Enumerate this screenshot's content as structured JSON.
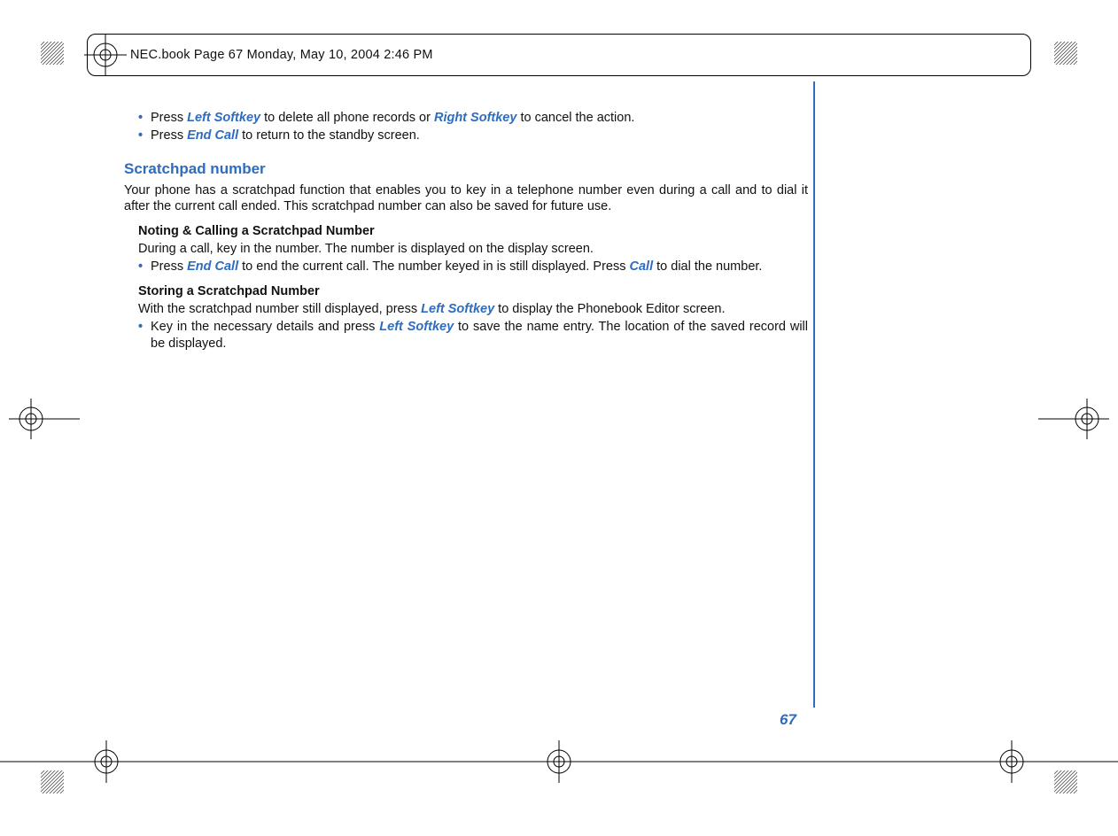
{
  "header": {
    "text": "NEC.book  Page 67  Monday, May 10, 2004  2:46 PM"
  },
  "content": {
    "topBullets": {
      "b1": {
        "t1": "Press ",
        "k1": "Left Softkey",
        "t2": " to delete all phone records or ",
        "k2": "Right Softkey",
        "t3": " to cancel the action."
      },
      "b2": {
        "t1": "Press ",
        "k1": "End Call",
        "t2": " to return to the standby screen."
      }
    },
    "section": {
      "title": "Scratchpad number",
      "intro": "Your phone has a scratchpad function that enables you to key in a telephone number even during a call and to dial it after the current call ended. This scratchpad number can also be saved for future use."
    },
    "noting": {
      "heading": "Noting & Calling a Scratchpad Number",
      "line": "During a call, key in the number. The number is displayed on the display screen.",
      "bullet": {
        "t1": "Press ",
        "k1": "End Call",
        "t2": " to end the current call. The number keyed in is still displayed. Press ",
        "k2": "Call",
        "t3": " to dial the number."
      }
    },
    "storing": {
      "heading": "Storing a Scratchpad Number",
      "line": {
        "t1": "With the scratchpad number still displayed, press ",
        "k1": "Left Softkey",
        "t2": " to display the Phonebook Editor screen."
      },
      "bullet": {
        "t1": "Key in the necessary details and press ",
        "k1": "Left Softkey",
        "t2": " to save the name entry. The location of the saved record will be displayed."
      }
    }
  },
  "pageNumber": "67"
}
